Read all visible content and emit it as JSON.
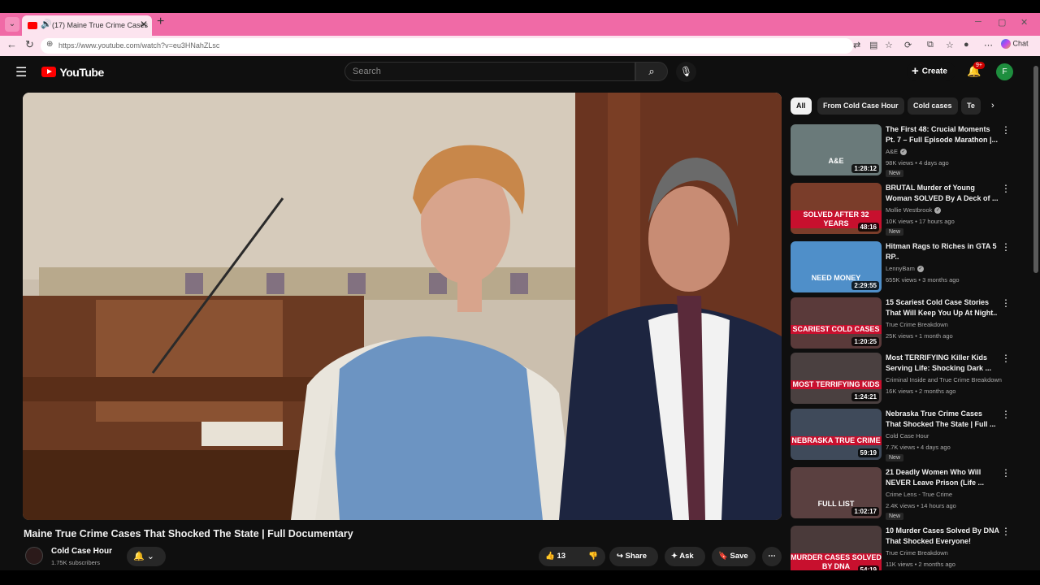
{
  "browser": {
    "tab_title": "(17) Maine True Crime Cases",
    "url": "https://www.youtube.com/watch?v=eu3HNahZLsc",
    "chat_label": "Chat"
  },
  "youtube": {
    "logo": "YouTube",
    "search_placeholder": "Search",
    "create_label": "Create",
    "notif_count": "9+",
    "avatar_letter": "F"
  },
  "video": {
    "title": "Maine True Crime Cases That Shocked The State | Full Documentary",
    "channel": "Cold Case Hour",
    "subscribers": "1.75K subscribers",
    "likes": "13",
    "share_label": "Share",
    "ask_label": "Ask",
    "save_label": "Save"
  },
  "chips": [
    "All",
    "From Cold Case Hour",
    "Cold cases",
    "Te"
  ],
  "recommendations": [
    {
      "title": "The First 48: Crucial Moments Pt. 7 – Full Episode Marathon |...",
      "channel": "A&E",
      "verified": true,
      "meta": "98K views • 4 days ago",
      "duration": "1:28:12",
      "new": "New",
      "thumb_text": "A&E",
      "thumb_bg": "#6a7a7a"
    },
    {
      "title": "BRUTAL Murder of Young Woman SOLVED By A Deck of ...",
      "channel": "Mollie Westbrook",
      "verified": true,
      "meta": "10K views • 17 hours ago",
      "duration": "48:16",
      "new": "New",
      "thumb_text": "SOLVED AFTER 32 YEARS",
      "thumb_bg": "#7a3d2a"
    },
    {
      "title": "Hitman Rags to Riches in GTA 5 RP..",
      "channel": "LennyBam",
      "verified": true,
      "meta": "655K views • 3 months ago",
      "duration": "2:29:55",
      "new": "",
      "thumb_text": "NEED MONEY",
      "thumb_bg": "#4f8fc9"
    },
    {
      "title": "15 Scariest Cold Case Stories That Will Keep You Up At Night..",
      "channel": "True Crime Breakdown",
      "verified": false,
      "meta": "25K views • 1 month ago",
      "duration": "1:20:25",
      "new": "",
      "thumb_text": "SCARIEST COLD CASES",
      "thumb_bg": "#5a3a3a"
    },
    {
      "title": "Most TERRIFYING Killer Kids Serving Life: Shocking Dark ...",
      "channel": "Criminal Inside and True Crime Breakdown",
      "verified": false,
      "meta": "16K views • 2 months ago",
      "duration": "1:24:21",
      "new": "",
      "thumb_text": "MOST TERRIFYING KIDS",
      "thumb_bg": "#4a4040"
    },
    {
      "title": "Nebraska True Crime Cases That Shocked The State | Full ...",
      "channel": "Cold Case Hour",
      "verified": false,
      "meta": "7.7K views • 4 days ago",
      "duration": "59:19",
      "new": "New",
      "thumb_text": "NEBRASKA TRUE CRIME",
      "thumb_bg": "#3f4a5a"
    },
    {
      "title": "21 Deadly Women Who Will NEVER Leave Prison (Life ...",
      "channel": "Crime Lens - True Crime",
      "verified": false,
      "meta": "2.4K views • 14 hours ago",
      "duration": "1:02:17",
      "new": "New",
      "thumb_text": "FULL LIST",
      "thumb_bg": "#5a4040"
    },
    {
      "title": "10 Murder Cases Solved By DNA That Shocked Everyone!",
      "channel": "True Crime Breakdown",
      "verified": false,
      "meta": "11K views • 2 months ago",
      "duration": "54:19",
      "new": "",
      "thumb_text": "MURDER CASES SOLVED BY DNA",
      "thumb_bg": "#4a3a3a"
    }
  ]
}
